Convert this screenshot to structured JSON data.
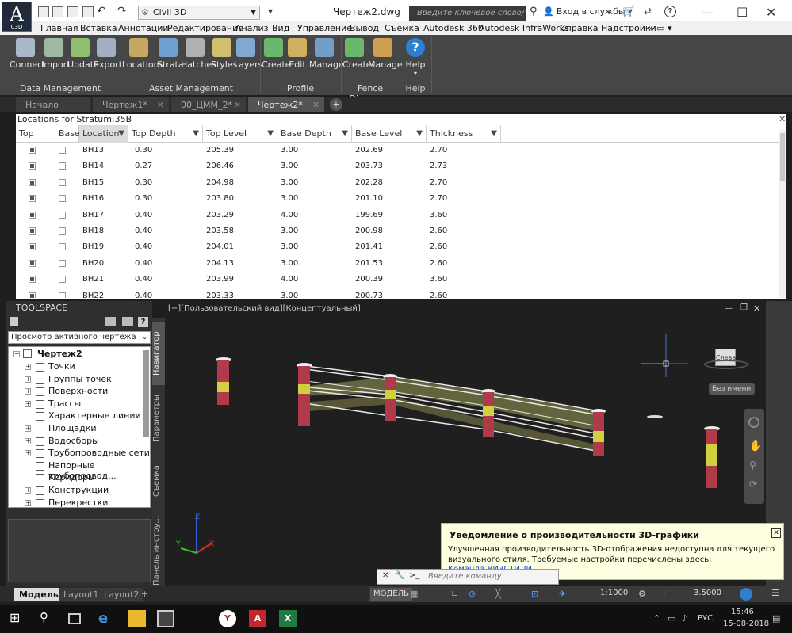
{
  "app": {
    "logo_letter": "A",
    "logo_sub": "C3D",
    "workspace": "Civil 3D",
    "doc_title": "Чертеж2.dwg",
    "search_placeholder": "Введите ключевое слово/фразу",
    "login": "Вход в службы"
  },
  "menu": [
    "Главная",
    "Вставка",
    "Аннотации",
    "Редактирование",
    "Анализ",
    "Вид",
    "Управление",
    "Вывод",
    "Съемка",
    "Autodesk 360",
    "Autodesk InfraWorks",
    "Справка",
    "Надстройки"
  ],
  "ribbon": {
    "data_management": {
      "label": "Data Management",
      "buttons": [
        "Connect",
        "Import",
        "Update",
        "Export"
      ]
    },
    "asset_management": {
      "label": "Asset Management",
      "buttons": [
        "Locations",
        "Strata",
        "Hatches",
        "Styles",
        "Layers"
      ]
    },
    "profile": {
      "label": "Profile",
      "buttons": [
        "Create",
        "Edit",
        "Manage"
      ]
    },
    "fence": {
      "label": "Fence Diagrams",
      "buttons": [
        "Create",
        "Manage"
      ]
    },
    "help": {
      "label": "Help",
      "buttons": [
        "Help"
      ]
    }
  },
  "doc_tabs": [
    {
      "label": "Начало"
    },
    {
      "label": "Чертеж1*"
    },
    {
      "label": "00_ЦММ_2*"
    },
    {
      "label": "Чертеж2*"
    }
  ],
  "locations": {
    "title": "Locations for Stratum:35B",
    "columns": [
      "Top",
      "Base",
      "Location",
      "Top Depth",
      "Top Level",
      "Base Depth",
      "Base Level",
      "Thickness"
    ],
    "rows": [
      {
        "top": true,
        "base": false,
        "loc": "BH13",
        "td": "0.30",
        "tl": "205.39",
        "bd": "3.00",
        "bl": "202.69",
        "th": "2.70"
      },
      {
        "top": true,
        "base": false,
        "loc": "BH14",
        "td": "0.27",
        "tl": "206.46",
        "bd": "3.00",
        "bl": "203.73",
        "th": "2.73"
      },
      {
        "top": true,
        "base": false,
        "loc": "BH15",
        "td": "0.30",
        "tl": "204.98",
        "bd": "3.00",
        "bl": "202.28",
        "th": "2.70"
      },
      {
        "top": true,
        "base": false,
        "loc": "BH16",
        "td": "0.30",
        "tl": "203.80",
        "bd": "3.00",
        "bl": "201.10",
        "th": "2.70"
      },
      {
        "top": true,
        "base": false,
        "loc": "BH17",
        "td": "0.40",
        "tl": "203.29",
        "bd": "4.00",
        "bl": "199.69",
        "th": "3.60"
      },
      {
        "top": true,
        "base": false,
        "loc": "BH18",
        "td": "0.40",
        "tl": "203.58",
        "bd": "3.00",
        "bl": "200.98",
        "th": "2.60"
      },
      {
        "top": true,
        "base": false,
        "loc": "BH19",
        "td": "0.40",
        "tl": "204.01",
        "bd": "3.00",
        "bl": "201.41",
        "th": "2.60"
      },
      {
        "top": true,
        "base": false,
        "loc": "BH20",
        "td": "0.40",
        "tl": "204.13",
        "bd": "3.00",
        "bl": "201.53",
        "th": "2.60"
      },
      {
        "top": true,
        "base": false,
        "loc": "BH21",
        "td": "0.40",
        "tl": "203.99",
        "bd": "4.00",
        "bl": "200.39",
        "th": "3.60"
      },
      {
        "top": true,
        "base": false,
        "loc": "BH22",
        "td": "0.40",
        "tl": "203.33",
        "bd": "3.00",
        "bl": "200.73",
        "th": "2.60"
      }
    ]
  },
  "toolspace": {
    "title": "TOOLSPACE",
    "view": "Просмотр активного чертежа",
    "root": "Чертеж2",
    "items": [
      "Точки",
      "Группы точек",
      "Поверхности",
      "Трассы",
      "Характерные линии",
      "Площадки",
      "Водосборы",
      "Трубопроводные сети",
      "Напорные трубопровод...",
      "Коридоры",
      "Конструкции",
      "Перекрестки"
    ]
  },
  "side_tabs": [
    "Навигатор",
    "Параметры",
    "Съемка",
    "Панель инстру..."
  ],
  "viewport": {
    "label": "[−][Пользовательский вид][Концептуальный]",
    "viewcube_face": "Слева",
    "named_view": "Без имени",
    "axis_x": "X",
    "axis_y": "Y",
    "axis_z": "Z"
  },
  "notification": {
    "title": "Уведомление о производительности 3D-графики",
    "body": "Улучшенная производительность 3D-отображения недоступна для текущего визуального стиля. Требуемые настройки перечислены здесь:",
    "link_prefix": "Команда",
    "link": "ВИЗСТИЛИ"
  },
  "command": {
    "placeholder": "Введите команду"
  },
  "layout_tabs": [
    "Модель",
    "Layout1",
    "Layout2"
  ],
  "status": {
    "model": "МОДЕЛЬ",
    "scale": "1:1000",
    "value": "3.5000"
  },
  "taskbar": {
    "lang": "РУС",
    "time": "15:46",
    "date": "15-08-2018"
  }
}
